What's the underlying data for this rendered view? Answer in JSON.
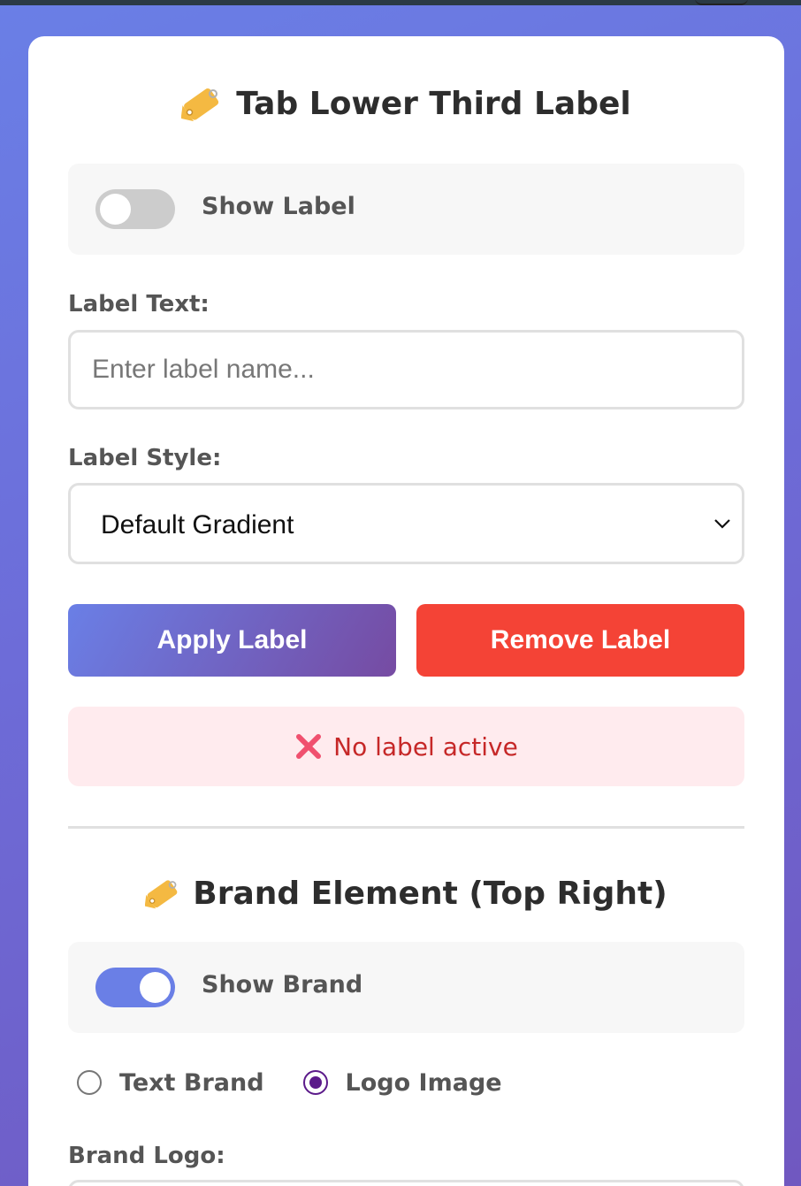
{
  "label_section": {
    "title": "Tab Lower Third Label",
    "title_icon": "tag-icon",
    "toggle": {
      "label": "Show Label",
      "state": "off"
    },
    "text_field": {
      "label": "Label Text:",
      "value": "",
      "placeholder": "Enter label name..."
    },
    "style_field": {
      "label": "Label Style:",
      "selected": "Default Gradient"
    },
    "apply_button": "Apply Label",
    "remove_button": "Remove Label",
    "status": {
      "icon": "cross-mark-icon",
      "text": "No label active"
    }
  },
  "brand_section": {
    "title": "Brand Element (Top Right)",
    "title_icon": "tag-icon",
    "toggle": {
      "label": "Show Brand",
      "state": "on"
    },
    "brand_type": {
      "options": [
        "Text Brand",
        "Logo Image"
      ],
      "selected": "Logo Image"
    },
    "logo_field": {
      "label": "Brand Logo:"
    }
  },
  "colors": {
    "accent": "#6a7fe6",
    "accent_end": "#764ba2",
    "danger": "#f44336",
    "status_bg": "#ffebee",
    "status_text": "#c62828"
  }
}
